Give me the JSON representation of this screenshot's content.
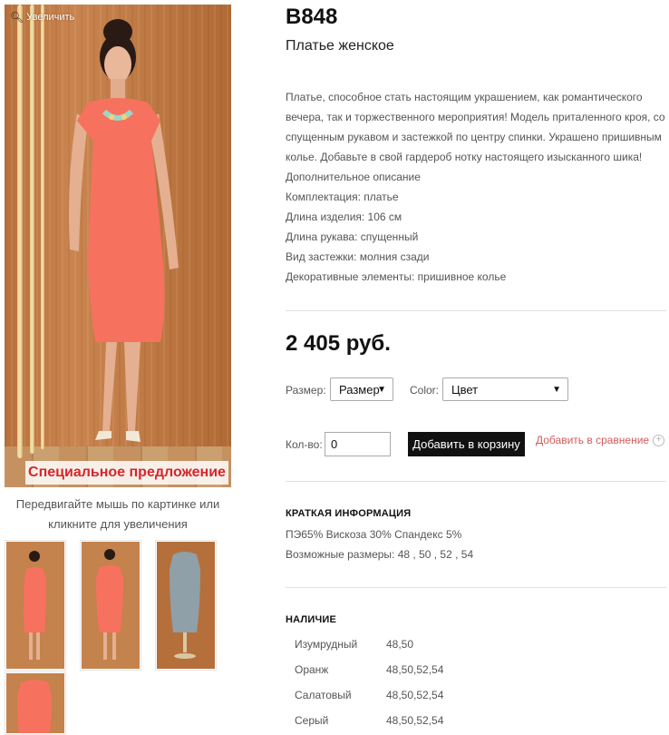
{
  "gallery": {
    "zoom_label": "Увеличить",
    "special_offer": "Специальное предложение",
    "hint": "Передвигайте мышь по картинке или кликните для увеличения"
  },
  "product": {
    "sku": "B848",
    "subtitle": "Платье женское",
    "description": [
      "Платье, способное стать настоящим украшением, как романтического вечера, так и торжественного мероприятия! Модель приталенного кроя, со спущенным рукавом и застежкой по центру спинки. Украшено пришивным колье. Добавьте в свой гардероб нотку настоящего изысканного шика!",
      "Дополнительное описание",
      "Комплектация: платье",
      "Длина изделия: 106 см",
      "Длина рукава: спущенный",
      "Вид застежки: молния сзади",
      "Декоративные элементы: пришивное колье"
    ],
    "price": "2 405 руб."
  },
  "options": {
    "size_label": "Размер:",
    "size_value": "Размер",
    "color_label": "Color:",
    "color_value": "Цвет",
    "qty_label": "Кол-во:",
    "qty_value": "0",
    "add_to_cart": "Добавить в корзину",
    "add_to_compare": "Добавить в сравнение"
  },
  "brief": {
    "title": "КРАТКАЯ ИНФОРМАЦИЯ",
    "composition": "ПЭ65% Вискоза 30% Спандекс 5%",
    "sizes": "Возможные размеры: 48 , 50 , 52 , 54"
  },
  "availability": {
    "title": "НАЛИЧИЕ",
    "rows": [
      {
        "color": "Изумрудный",
        "sizes": "48,50"
      },
      {
        "color": "Оранж",
        "sizes": "48,50,52,54"
      },
      {
        "color": "Салатовый",
        "sizes": "48,50,52,54"
      },
      {
        "color": "Серый",
        "sizes": "48,50,52,54"
      }
    ]
  },
  "colors": {
    "dress_coral": "#f7715f",
    "dress_grey": "#8fa0a8",
    "accent_red": "#d6262c",
    "compare_link": "#d35b5b",
    "cart_button": "#111111"
  }
}
